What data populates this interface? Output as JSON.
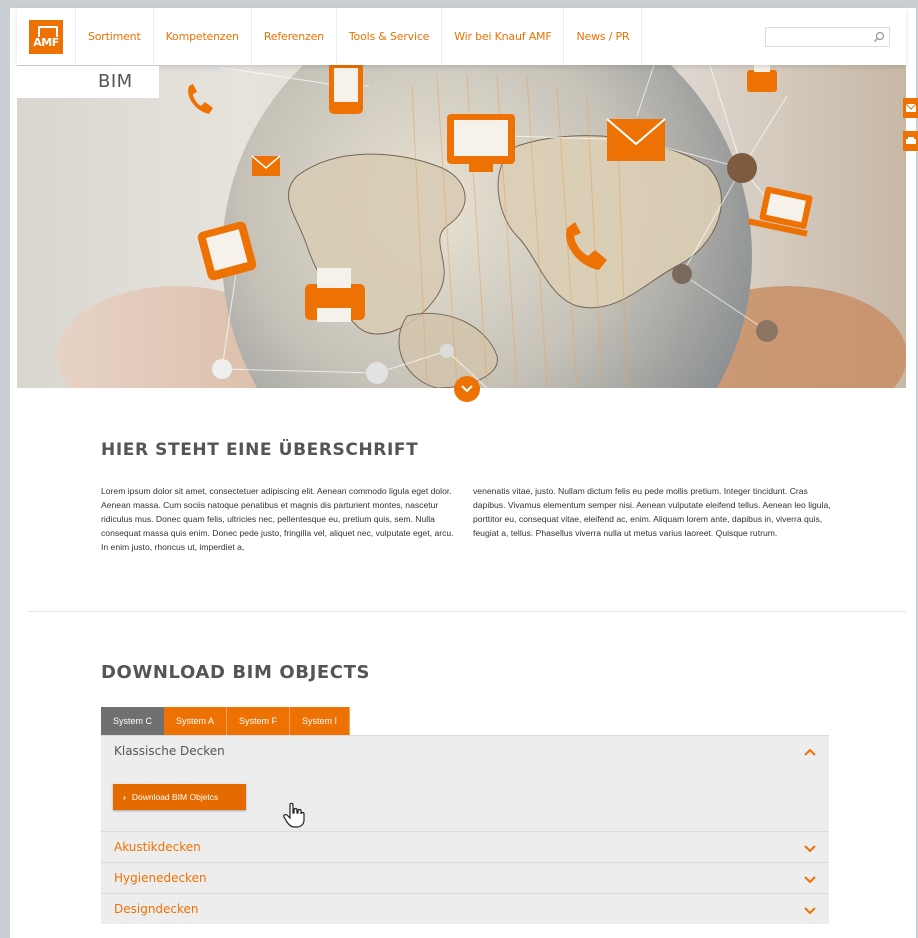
{
  "nav": {
    "logo_text": "AMF",
    "items": [
      "Sortiment",
      "Kompetenzen",
      "Referenzen",
      "Tools & Service",
      "Wir bei Knauf AMF",
      "News / PR"
    ],
    "search_placeholder": ""
  },
  "hero": {
    "page_label": "BIM"
  },
  "article": {
    "title": "HIER STEHT EINE ÜBERSCHRIFT",
    "col1": "Lorem ipsum dolor sit amet, consectetuer adipiscing elit. Aenean commodo ligula eget dolor. Aenean massa. Cum sociis natoque penatibus et magnis dis parturient montes, nascetur ridiculus mus. Donec quam felis, ultricies nec, pellentesque eu, pretium quis, sem. Nulla consequat massa quis enim. Donec pede justo, fringilla vel, aliquet nec, vulputate eget, arcu. In enim justo, rhoncus ut, imperdiet a,",
    "col2": "venenatis vitae, justo. Nullam dictum felis eu pede mollis pretium. Integer tincidunt. Cras dapibus. Vivamus elementum semper nisi. Aenean vulputate eleifend tellus. Aenean leo ligula, porttitor eu, consequat vitae, eleifend ac, enim. Aliquam lorem ante, dapibus in, viverra quis, feugiat a, tellus. Phasellus viverra nulla ut metus varius laoreet. Quisque rutrum."
  },
  "download": {
    "title": "DOWNLOAD BIM OBJECTS",
    "tabs": [
      "System C",
      "System A",
      "System F",
      "System I"
    ],
    "open_section": {
      "title": "Klassische Decken",
      "button_label": "Download BIM Objetcs"
    },
    "sections": [
      "Akustikdecken",
      "Hygienedecken",
      "Designdecken"
    ]
  },
  "colors": {
    "accent": "#ee7203",
    "tab_active": "#707070",
    "panel": "#ededed"
  }
}
